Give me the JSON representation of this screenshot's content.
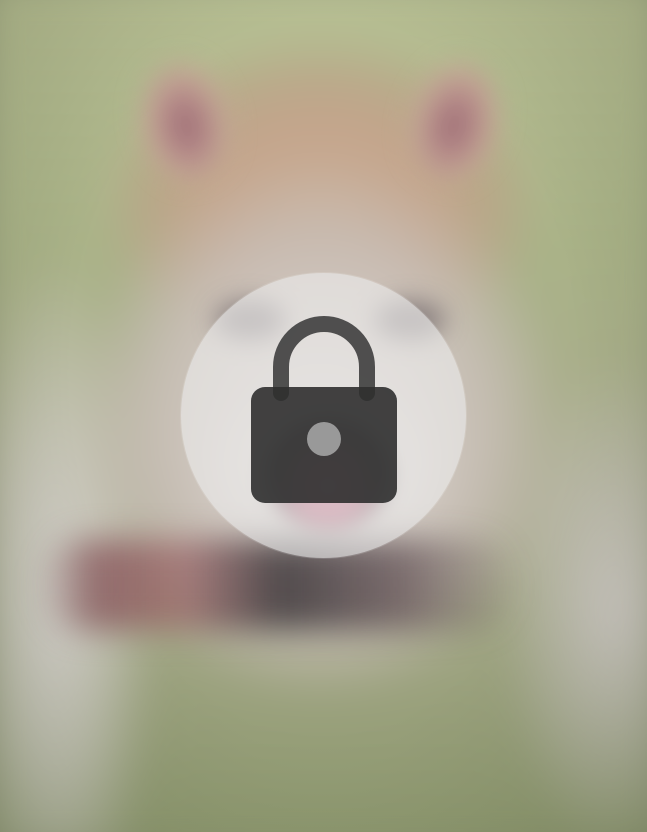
{
  "screen": {
    "content": "blurred-photo",
    "overlay_icon": "lock-icon"
  },
  "colors": {
    "badge_fill": "#ebebeb",
    "lock_fill": "#3a3a3a",
    "keyhole": "#9e9e9e"
  }
}
